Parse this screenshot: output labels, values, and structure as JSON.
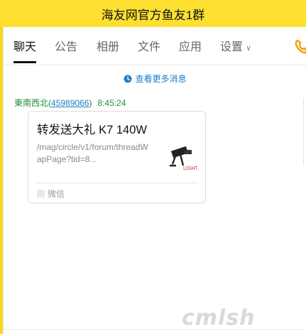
{
  "window": {
    "title": "海友网官方鱼友1群"
  },
  "tabs": [
    {
      "label": "聊天",
      "active": true
    },
    {
      "label": "公告"
    },
    {
      "label": "相册"
    },
    {
      "label": "文件"
    },
    {
      "label": "应用"
    },
    {
      "label": "设置"
    }
  ],
  "chat": {
    "more_messages": "查看更多消息",
    "sender_name": "東南西北",
    "sender_id": "45989066",
    "time": "8:45:24",
    "card": {
      "title": "转发送大礼 K7 140W",
      "url": "/mag/circle/v1/forum/threadWapPage?tid=8...",
      "source": "微信"
    }
  },
  "watermark": "cmlsh",
  "colors": {
    "title_bar": "#fee030",
    "link_blue": "#1e7ec8",
    "sender_green": "#1d8f3f"
  }
}
